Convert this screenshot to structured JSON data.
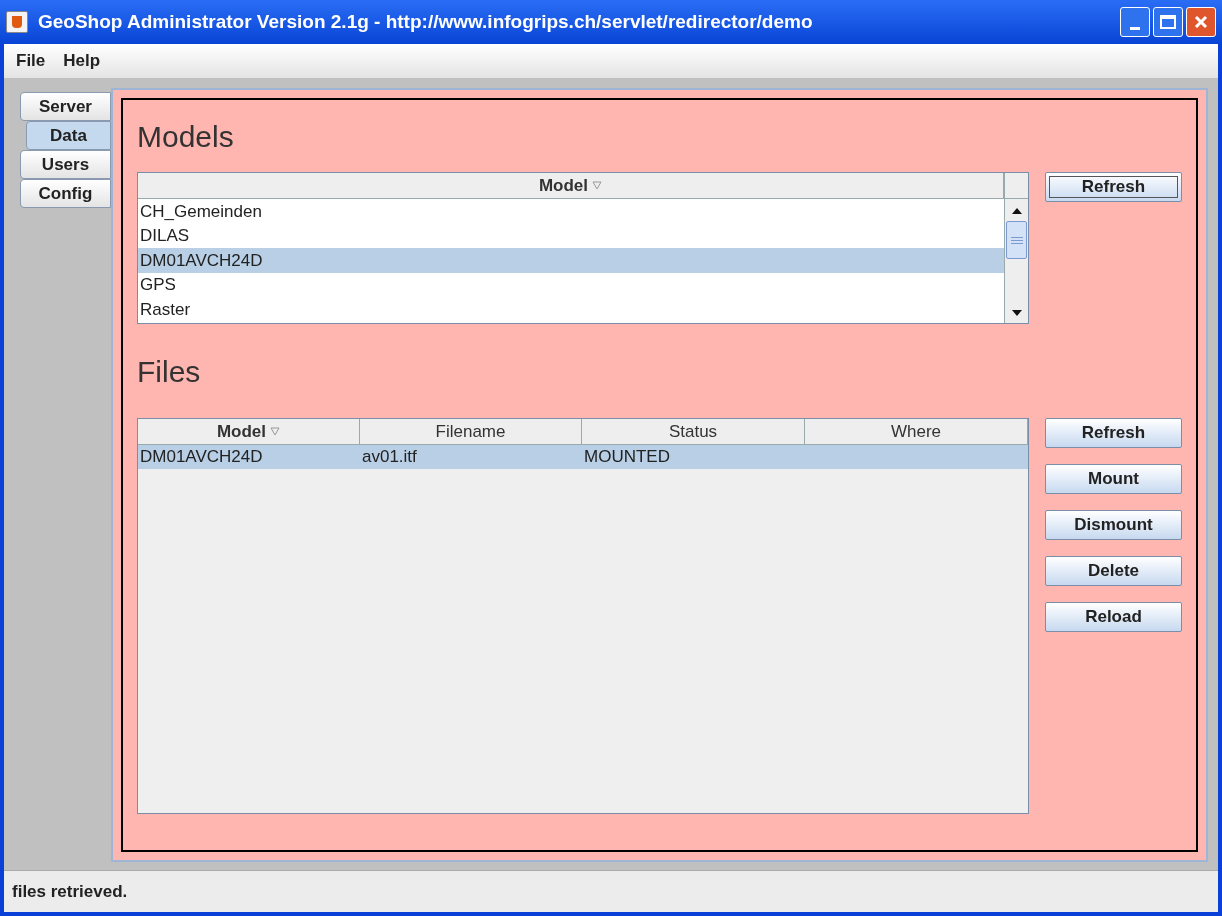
{
  "window": {
    "title": "GeoShop Administrator Version 2.1g - http://www.infogrips.ch/servlet/redirector/demo"
  },
  "menu": [
    "File",
    "Help"
  ],
  "tabs": [
    {
      "label": "Server",
      "selected": false
    },
    {
      "label": "Data",
      "selected": true
    },
    {
      "label": "Users",
      "selected": false
    },
    {
      "label": "Config",
      "selected": false
    }
  ],
  "models": {
    "heading": "Models",
    "columns": [
      {
        "label": "Model",
        "sorted": true
      }
    ],
    "rows": [
      {
        "cells": [
          "CH_Gemeinden"
        ],
        "selected": false
      },
      {
        "cells": [
          "DILAS"
        ],
        "selected": false
      },
      {
        "cells": [
          "DM01AVCH24D"
        ],
        "selected": true
      },
      {
        "cells": [
          "GPS"
        ],
        "selected": false
      },
      {
        "cells": [
          "Raster"
        ],
        "selected": false
      }
    ],
    "buttons": [
      {
        "label": "Refresh",
        "focused": true
      }
    ]
  },
  "files": {
    "heading": "Files",
    "columns": [
      {
        "label": "Model",
        "sorted": true
      },
      {
        "label": "Filename",
        "sorted": false
      },
      {
        "label": "Status",
        "sorted": false
      },
      {
        "label": "Where",
        "sorted": false
      }
    ],
    "rows": [
      {
        "cells": [
          "DM01AVCH24D",
          "av01.itf",
          "MOUNTED",
          ""
        ],
        "selected": true
      }
    ],
    "buttons": [
      {
        "label": "Refresh",
        "focused": false
      },
      {
        "label": "Mount",
        "focused": false
      },
      {
        "label": "Dismount",
        "focused": false
      },
      {
        "label": "Delete",
        "focused": false
      },
      {
        "label": "Reload",
        "focused": false
      }
    ]
  },
  "status_bar": "files retrieved."
}
